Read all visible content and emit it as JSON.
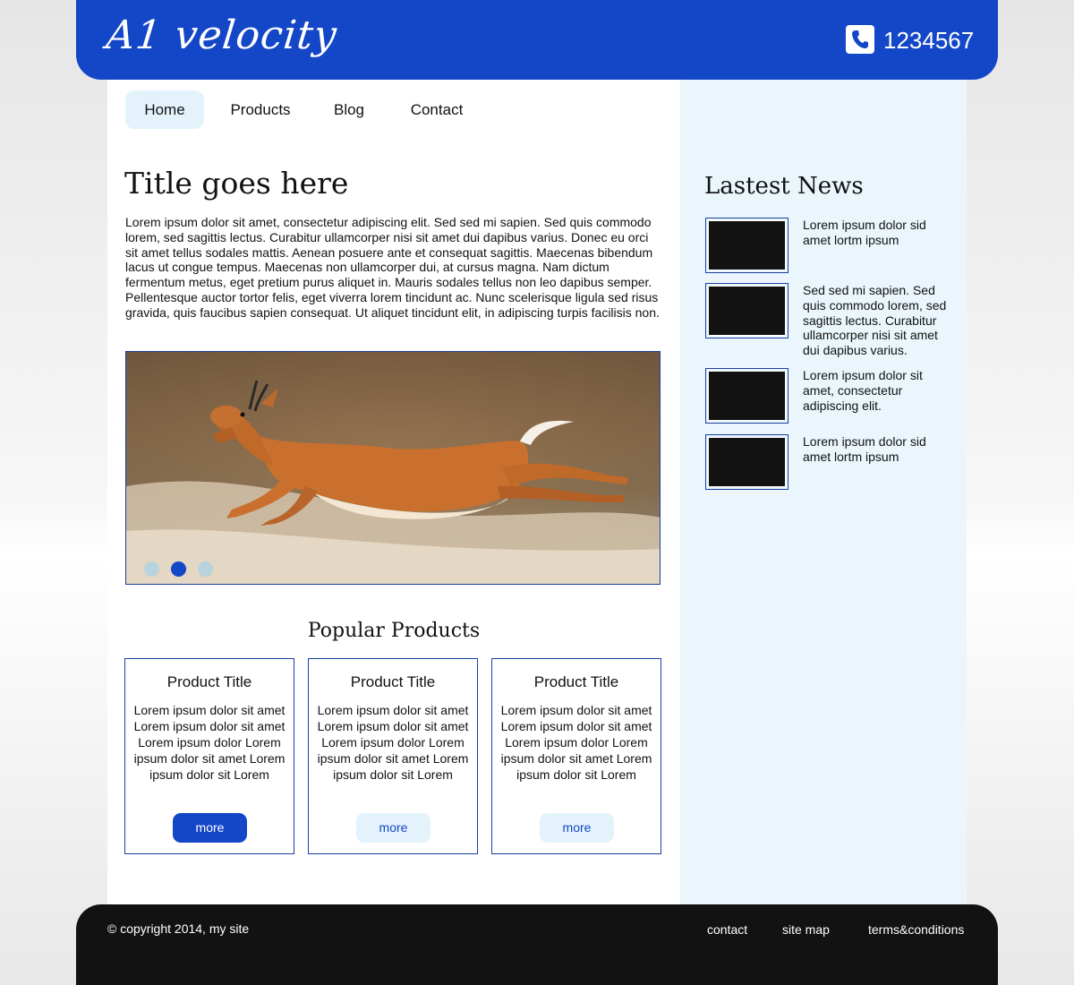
{
  "header": {
    "logo": "A1 velocity",
    "phone_icon": "phone-icon",
    "phone_number": "1234567",
    "brand_color": "#1446c8"
  },
  "nav": {
    "items": [
      {
        "label": "Home",
        "active": true
      },
      {
        "label": "Products",
        "active": false
      },
      {
        "label": "Blog",
        "active": false
      },
      {
        "label": "Contact",
        "active": false
      }
    ]
  },
  "main": {
    "title": "Title goes here",
    "intro": "Lorem ipsum dolor sit amet, consectetur adipiscing elit. Sed sed mi sapien. Sed quis commodo lorem, sed sagittis lectus. Curabitur ullamcorper nisi sit amet dui dapibus varius. Donec eu orci sit amet tellus sodales mattis. Aenean posuere ante et consequat sagittis. Maecenas bibendum lacus ut congue tempus. Maecenas non ullamcorper dui, at cursus magna. Nam dictum fermentum metus, eget pretium purus aliquet in. Mauris sodales tellus non leo dapibus semper. Pellentesque auctor tortor felis, eget viverra lorem tincidunt ac. Nunc scelerisque ligula sed risus gravida, quis faucibus sapien consequat. Ut aliquet tincidunt elit, in adipiscing turpis facilisis non.",
    "slider": {
      "image": "leaping impala",
      "slide_count": 3,
      "active_slide": 2
    },
    "popular_title": "Popular Products",
    "products": [
      {
        "title": "Product Title",
        "text": "Lorem ipsum dolor sit amet Lorem ipsum dolor sit amet Lorem ipsum dolor  Lorem ipsum dolor sit amet Lorem ipsum dolor sit Lorem",
        "button": "more"
      },
      {
        "title": "Product Title",
        "text": "Lorem ipsum dolor sit amet Lorem ipsum dolor sit amet Lorem ipsum dolor  Lorem ipsum dolor sit amet Lorem ipsum dolor sit Lorem",
        "button": "more"
      },
      {
        "title": "Product Title",
        "text": "Lorem ipsum dolor sit amet Lorem ipsum dolor sit amet Lorem ipsum dolor  Lorem ipsum dolor sit amet Lorem ipsum dolor sit Lorem",
        "button": "more"
      }
    ]
  },
  "sidebar": {
    "title": "Lastest News",
    "news": [
      {
        "text": "Lorem ipsum dolor sid amet lortm ipsum"
      },
      {
        "text": "Sed sed mi sapien. Sed quis commodo lorem, sed sagittis lectus. Curabitur ullamcorper nisi sit amet dui dapibus varius."
      },
      {
        "text": "Lorem ipsum dolor sit amet, consectetur adipiscing elit."
      },
      {
        "text": "Lorem ipsum dolor sid amet lortm ipsum"
      }
    ]
  },
  "footer": {
    "copyright": "© copyright 2014, my site",
    "links": [
      "contact",
      "site map",
      "terms&conditions"
    ]
  }
}
